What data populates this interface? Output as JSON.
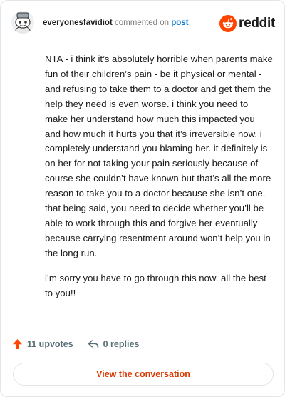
{
  "comment": {
    "username": "everyonesfavidiot",
    "action_text": "commented on",
    "target_link": "post",
    "brand_name": "reddit",
    "brand_color": "#ff4500",
    "paragraphs": [
      "NTA - i think it’s absolutely horrible when parents make fun of their children’s pain - be it physical or mental - and refusing to take them to a doctor and get them the help they need is even worse. i think you need to make her understand how much this impacted you and how much it hurts you that it’s irreversible now. i completely understand you blaming her. it definitely is on her for not taking your pain seriously because of course she couldn’t have known but that’s all the more reason to take you to a doctor because she isn’t one. that being said, you need to decide whether you’ll be able to work through this and forgive her eventually because carrying resentment around won’t help you in the long run.",
      "i’m sorry you have to go through this now. all the best to you!!"
    ]
  },
  "stats": {
    "upvotes_label": "11 upvotes",
    "replies_label": "0 replies",
    "upvote_color": "#ff4500"
  },
  "cta": {
    "label": "View the conversation",
    "color": "#d93a00"
  },
  "icons": {
    "avatar": "snoo-avatar-icon",
    "brand": "reddit-snoo-icon",
    "upvote": "upvote-arrow-icon",
    "reply": "reply-arrow-icon"
  }
}
